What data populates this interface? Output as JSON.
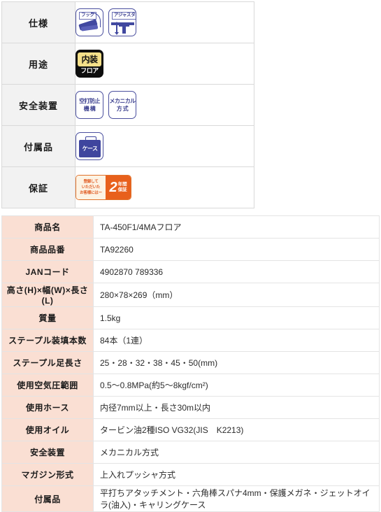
{
  "feature_table": {
    "rows": [
      {
        "label": "仕様",
        "icons": [
          {
            "name": "hook-icon",
            "caption": "フック"
          },
          {
            "name": "adjuster-icon",
            "caption": "アジャスタ"
          }
        ]
      },
      {
        "label": "用途",
        "icons": [
          {
            "name": "interior-floor-icon",
            "top": "内装",
            "bottom": "フロア"
          }
        ]
      },
      {
        "label": "安全装置",
        "icons": [
          {
            "name": "dry-fire-prevention-icon",
            "line1": "空打防止",
            "line2": "機 構"
          },
          {
            "name": "mechanical-type-icon",
            "line1": "メカニカル",
            "line2": "方 式"
          }
        ]
      },
      {
        "label": "付属品",
        "icons": [
          {
            "name": "carrying-case-icon",
            "caption": "ケース"
          }
        ]
      },
      {
        "label": "保証",
        "icons": [
          {
            "name": "warranty-badge",
            "left_line1": "登録して",
            "left_line2": "いただいた",
            "left_line3": "お客様にはー",
            "number": "2",
            "right_line1": "年間",
            "right_line2": "保証"
          }
        ]
      }
    ]
  },
  "spec_table": {
    "rows": [
      {
        "key": "商品名",
        "value": "TA-450F1/4MAフロア"
      },
      {
        "key": "商品品番",
        "value": "TA92260"
      },
      {
        "key": "JANコード",
        "value": "4902870 789336"
      },
      {
        "key": "高さ(H)×幅(W)×長さ(L)",
        "value": "280×78×269（mm）"
      },
      {
        "key": "質量",
        "value": "1.5kg"
      },
      {
        "key": "ステープル装填本数",
        "value": "84本（1連）"
      },
      {
        "key": "ステープル足長さ",
        "value": "25・28・32・38・45・50(mm)"
      },
      {
        "key": "使用空気圧範囲",
        "value": "0.5〜0.8MPa(約5〜8kgf/cm²)"
      },
      {
        "key": "使用ホース",
        "value": "内径7mm以上・長さ30m以内"
      },
      {
        "key": "使用オイル",
        "value": "タービン油2種ISO VG32(JIS　K2213)"
      },
      {
        "key": "安全装置",
        "value": "メカニカル方式"
      },
      {
        "key": "マガジン形式",
        "value": "上入れプッシャ方式"
      },
      {
        "key": "付属品",
        "value": "平打ちアタッチメント・六角棒スパナ4mm・保護メガネ・ジェットオイラ(油入)・キャリングケース"
      }
    ]
  },
  "colors": {
    "feature_label_bg": "#f2f2f2",
    "spec_key_bg": "#fadfd3",
    "icon_blue": "#3f459e",
    "usage_yellow": "#f5e08a",
    "warranty_orange": "#e8601c"
  }
}
